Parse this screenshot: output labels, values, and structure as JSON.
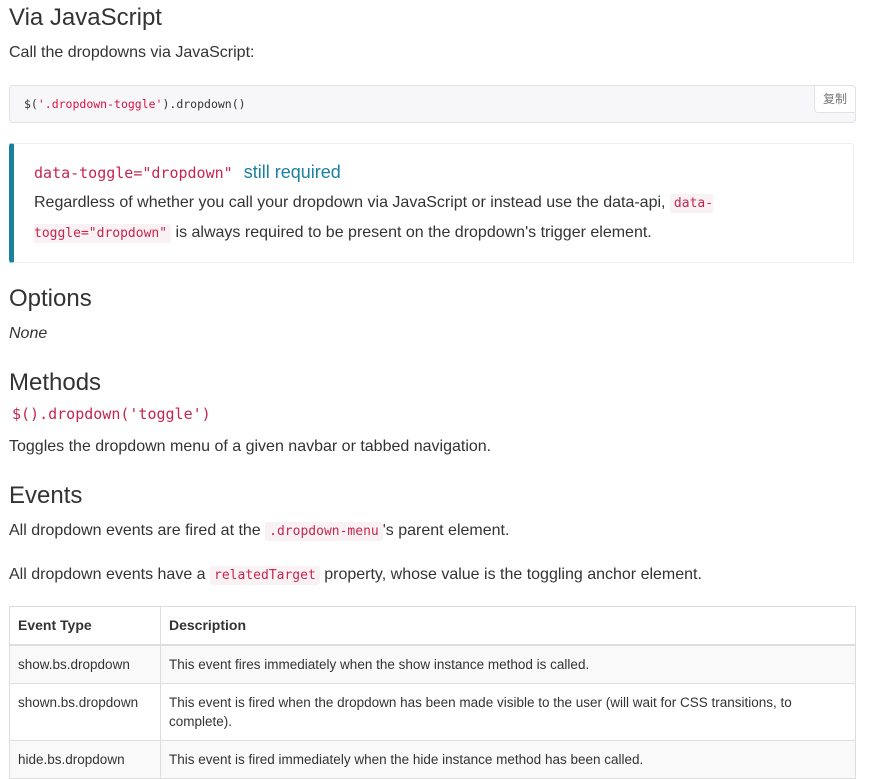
{
  "via_js": {
    "heading": "Via JavaScript",
    "intro": "Call the dropdowns via JavaScript:",
    "code": {
      "pre": "$(",
      "string": "'.dropdown-toggle'",
      "post": ").dropdown()"
    },
    "copy_label": "复制"
  },
  "callout": {
    "title_code": "data-toggle=\"dropdown\"",
    "title_text": "still required",
    "text_before": "Regardless of whether you call your dropdown via JavaScript or instead use the data-api,",
    "text_code": "data-toggle=\"dropdown\"",
    "text_after": "is always required to be present on the dropdown's trigger element."
  },
  "options": {
    "heading": "Options",
    "text": "None"
  },
  "methods": {
    "heading": "Methods",
    "signature": "$().dropdown('toggle')",
    "text": "Toggles the dropdown menu of a given navbar or tabbed navigation."
  },
  "events": {
    "heading": "Events",
    "p1_before": "All dropdown events are fired at the",
    "p1_code": ".dropdown-menu",
    "p1_after": "'s parent element.",
    "p2_before": "All dropdown events have a",
    "p2_code": "relatedTarget",
    "p2_after": "property, whose value is the toggling anchor element.",
    "table": {
      "headers": [
        "Event Type",
        "Description"
      ],
      "rows": [
        [
          "show.bs.dropdown",
          "This event fires immediately when the show instance method is called."
        ],
        [
          "shown.bs.dropdown",
          "This event is fired when the dropdown has been made visible to the user (will wait for CSS transitions, to complete)."
        ],
        [
          "hide.bs.dropdown",
          "This event is fired immediately when the hide instance method has been called."
        ]
      ]
    }
  }
}
